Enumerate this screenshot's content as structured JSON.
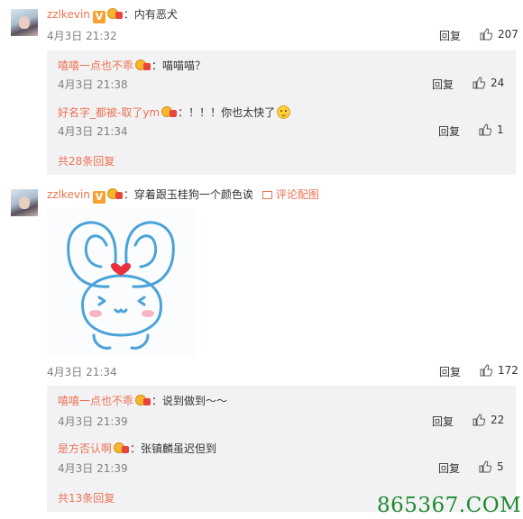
{
  "comments": [
    {
      "username": "zzlkevin",
      "v_badge": "V",
      "text": "：内有恶犬",
      "date": "4月3日 21:32",
      "reply_label": "回复",
      "likes": "207",
      "replies": [
        {
          "username": "嘻嘻一点也不乖",
          "text": "：喵喵喵？",
          "date": "4月3日 21:38",
          "reply_label": "回复",
          "likes": "24"
        },
        {
          "username": "好名字_都被-取了ym",
          "text": "：！！！你也太快了",
          "date": "4月3日 21:34",
          "reply_label": "回复",
          "likes": "1"
        }
      ],
      "more_replies": "共28条回复"
    },
    {
      "username": "zzlkevin",
      "v_badge": "V",
      "text": "：穿着跟玉桂狗一个颜色诶",
      "pic_link": "评论配图",
      "date": "4月3日 21:34",
      "reply_label": "回复",
      "likes": "172",
      "replies": [
        {
          "username": "嘻嘻一点也不乖",
          "text": "：说到做到～～",
          "date": "4月3日 21:39",
          "reply_label": "回复",
          "likes": "22"
        },
        {
          "username": "是方否认啊",
          "text": "：张镇麟虽迟但到",
          "date": "4月3日 21:39",
          "reply_label": "回复",
          "likes": "5"
        }
      ],
      "more_replies": "共13条回复"
    }
  ],
  "watermark": "865367.COM",
  "colors": {
    "username": "#eb7350",
    "meta": "#808080",
    "reply_box": "#f2f2f5",
    "watermark": "#1e8a2e"
  }
}
